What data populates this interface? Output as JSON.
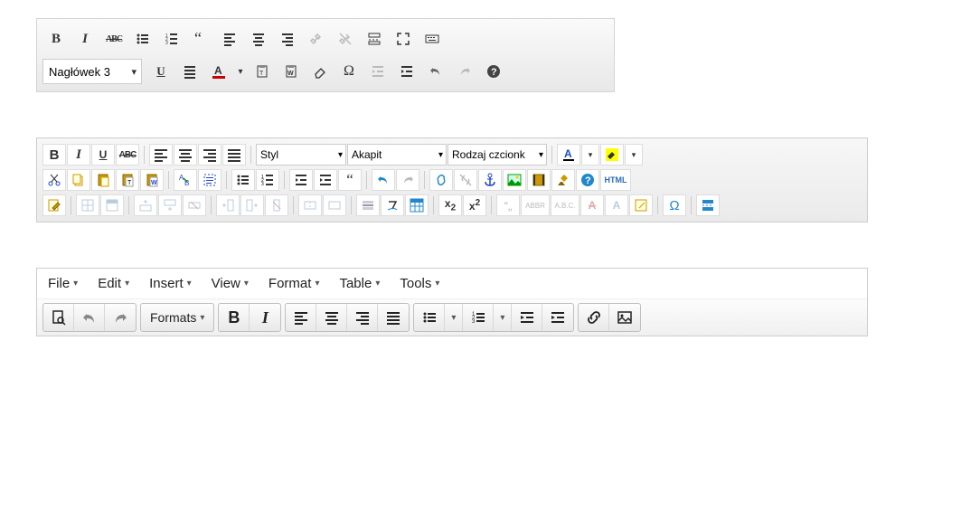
{
  "editor1": {
    "heading_label": "Nagłówek 3",
    "icons": {
      "bold": "B",
      "italic": "I",
      "strike": "ABC",
      "underline": "U"
    }
  },
  "editor2": {
    "bold": "B",
    "italic": "I",
    "underline": "U",
    "strike": "ABC",
    "style_label": "Styl",
    "format_label": "Akapit",
    "font_label": "Rodzaj czcionk",
    "fontcolor_letter": "A",
    "html_label": "HTML",
    "sub_label": "x",
    "sub_sub": "2",
    "sup_label": "x",
    "sup_sup": "2",
    "abbr_label": "ABBR",
    "abc_label": "A.B.C.",
    "strike_a": "A",
    "normal_a": "A",
    "omega": "Ω"
  },
  "editor3": {
    "menus": [
      "File",
      "Edit",
      "Insert",
      "View",
      "Format",
      "Table",
      "Tools"
    ],
    "formats_label": "Formats",
    "bold": "B",
    "italic": "I"
  }
}
